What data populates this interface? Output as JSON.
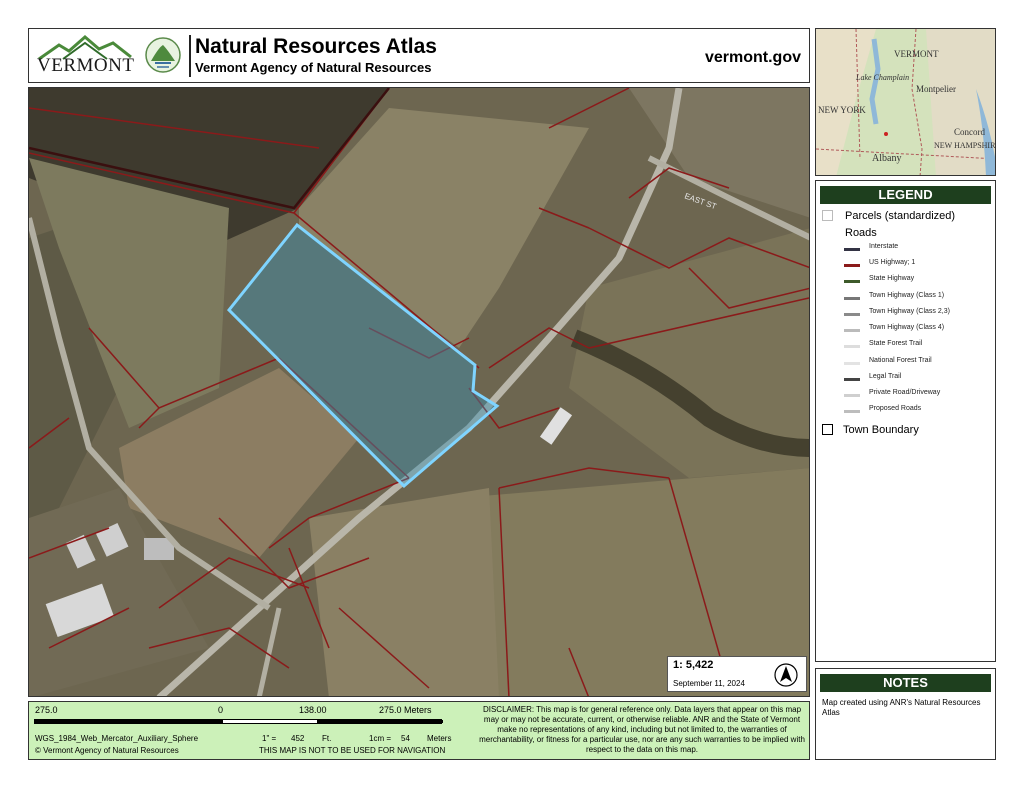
{
  "header": {
    "logo_text": "VERMONT",
    "title": "Natural Resources Atlas",
    "subtitle": "Vermont Agency of Natural Resources",
    "site": "vermont.gov"
  },
  "inset_map": {
    "labels": [
      "VERMONT",
      "Lake Champlain",
      "Montpelier",
      "NEW YORK",
      "NEW HAMPSHIRE",
      "Concord",
      "Albany"
    ]
  },
  "legend": {
    "title": "LEGEND",
    "parcels_label": "Parcels (standardized)",
    "roads_label": "Roads",
    "roads": [
      {
        "label": "Interstate",
        "color": "#333344"
      },
      {
        "label": "US Highway; 1",
        "color": "#8b1a1a"
      },
      {
        "label": "State Highway",
        "color": "#3d5a2a"
      },
      {
        "label": "Town Highway (Class 1)",
        "color": "#777777"
      },
      {
        "label": "Town Highway (Class 2,3)",
        "color": "#8a8a8a"
      },
      {
        "label": "Town Highway (Class 4)",
        "color": "#bbbbbb"
      },
      {
        "label": "State Forest Trail",
        "color": "#dddddd"
      },
      {
        "label": "National Forest Trail",
        "color": "#e3e3e3"
      },
      {
        "label": "Legal Trail",
        "color": "#444444"
      },
      {
        "label": "Private Road/Driveway",
        "color": "#cfcfcf"
      },
      {
        "label": "Proposed Roads",
        "color": "#bdbdbd"
      }
    ],
    "town_boundary_label": "Town Boundary"
  },
  "notes": {
    "title": "NOTES",
    "text": "Map created using ANR's Natural Resources Atlas"
  },
  "map": {
    "road_label": "EAST ST",
    "scale_ratio": "1:  5,422",
    "date": "September 11, 2024"
  },
  "footer": {
    "scale_left": "275.0",
    "scale_zero": "0",
    "scale_mid": "138.00",
    "scale_right": "275.0 Meters",
    "projection": "WGS_1984_Web_Mercator_Auxiliary_Sphere",
    "inch_eq": "1\" =",
    "inch_val": "452",
    "inch_unit": "Ft.",
    "cm_eq": "1cm =",
    "cm_val": "54",
    "cm_unit": "Meters",
    "copyright": "© Vermont Agency of Natural Resources",
    "nav_warning": "THIS MAP IS NOT TO BE USED FOR NAVIGATION",
    "disclaimer": "DISCLAIMER: This map is for general reference only. Data layers that appear on this map may or may not be accurate, current, or otherwise reliable. ANR and the State of Vermont make no representations of any kind, including but not limited to, the warranties of merchantability, or fitness for a particular use, nor are any such warranties to be implied with respect to the data on this map."
  }
}
